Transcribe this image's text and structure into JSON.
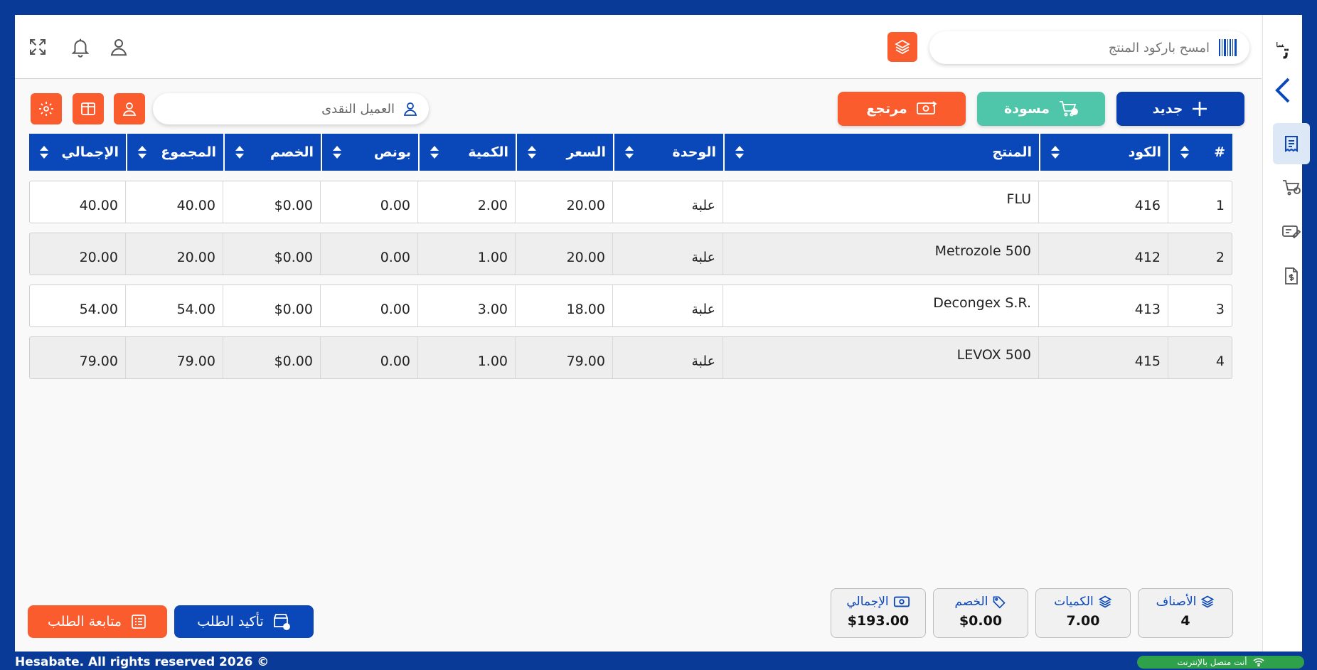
{
  "header": {
    "scan_placeholder": "امسح باركود المنتج"
  },
  "sidebar": {
    "logo": "ت",
    "logo_small": "سا"
  },
  "toolbar": {
    "new_label": "جديد",
    "draft_label": "مسودة",
    "return_label": "مرتجع",
    "customer_placeholder": "العميل النقدى"
  },
  "table": {
    "columns": [
      "#",
      "الكود",
      "المنتج",
      "الوحدة",
      "السعر",
      "الكمية",
      "بونص",
      "الخصم",
      "المجموع",
      "الإجمالي"
    ],
    "rows": [
      {
        "no": "1",
        "code": "416",
        "product": "FLU",
        "unit": "علبة",
        "price": "20.00",
        "qty": "2.00",
        "bonus": "0.00",
        "discount": "$0.00",
        "subtotal": "40.00",
        "total": "40.00"
      },
      {
        "no": "2",
        "code": "412",
        "product": "Metrozole 500",
        "unit": "علبة",
        "price": "20.00",
        "qty": "1.00",
        "bonus": "0.00",
        "discount": "$0.00",
        "subtotal": "20.00",
        "total": "20.00"
      },
      {
        "no": "3",
        "code": "413",
        "product": "Decongex S.R.",
        "unit": "علبة",
        "price": "18.00",
        "qty": "3.00",
        "bonus": "0.00",
        "discount": "$0.00",
        "subtotal": "54.00",
        "total": "54.00"
      },
      {
        "no": "4",
        "code": "415",
        "product": "LEVOX 500",
        "unit": "علبة",
        "price": "79.00",
        "qty": "1.00",
        "bonus": "0.00",
        "discount": "$0.00",
        "subtotal": "79.00",
        "total": "79.00"
      }
    ]
  },
  "totals": {
    "items_label": "الأصناف",
    "items_value": "4",
    "qty_label": "الكميات",
    "qty_value": "7.00",
    "discount_label": "الخصم",
    "discount_value": "$0.00",
    "total_label": "الإجمالي",
    "total_value": "$193.00"
  },
  "actions": {
    "confirm_label": "تأكيد الطلب",
    "follow_label": "متابعة الطلب"
  },
  "footer": {
    "copyright": "Hesabate. All rights reserved 2026 ©",
    "status": "أنت متصل بالإنترنت"
  },
  "colors": {
    "primary": "#0a47b8",
    "accent": "#fa5c2d",
    "success": "#4fc6a9",
    "online": "#2fa14a"
  }
}
